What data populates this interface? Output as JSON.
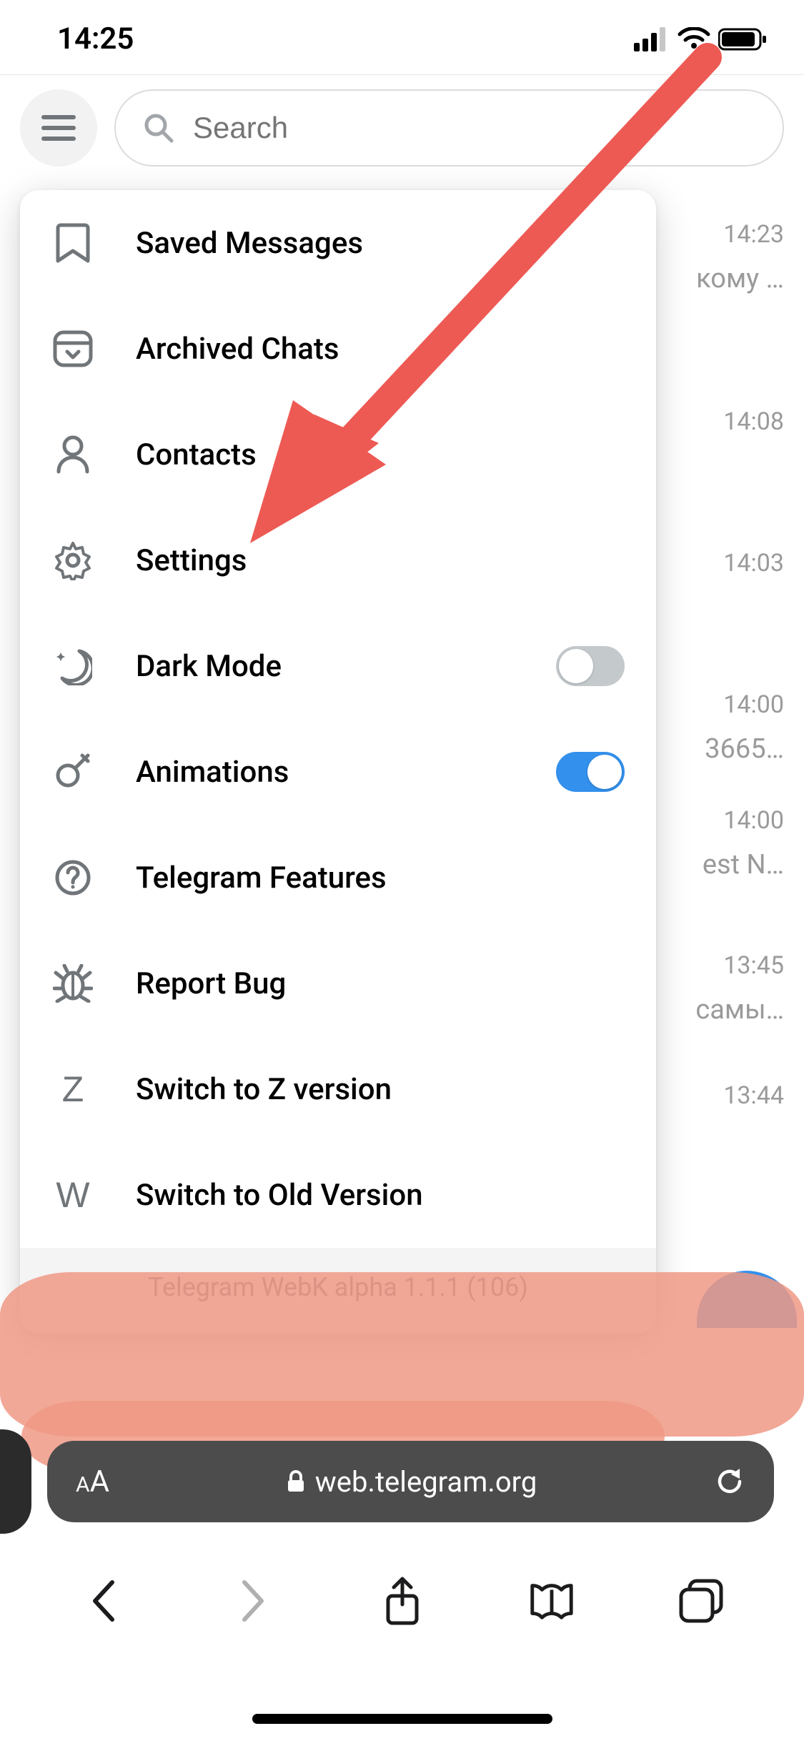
{
  "status": {
    "time": "14:25"
  },
  "search": {
    "placeholder": "Search"
  },
  "menu": {
    "items": [
      {
        "label": "Saved Messages",
        "icon": "bookmark"
      },
      {
        "label": "Archived Chats",
        "icon": "archive"
      },
      {
        "label": "Contacts",
        "icon": "user"
      },
      {
        "label": "Settings",
        "icon": "gear"
      },
      {
        "label": "Dark Mode",
        "icon": "moon",
        "toggle": false
      },
      {
        "label": "Animations",
        "icon": "sparkle",
        "toggle": true
      },
      {
        "label": "Telegram Features",
        "icon": "help"
      },
      {
        "label": "Report Bug",
        "icon": "bug"
      },
      {
        "label": "Switch to Z version",
        "icon": "Z"
      },
      {
        "label": "Switch to Old Version",
        "icon": "W"
      }
    ],
    "footer": "Telegram WebK alpha 1.1.1 (106)"
  },
  "chats_peek": [
    {
      "time": "14:23",
      "snippet": "кому …"
    },
    {
      "time": "14:08",
      "snippet": ""
    },
    {
      "time": "14:03",
      "snippet": ""
    },
    {
      "time": "14:00",
      "snippet": "3665…"
    },
    {
      "time": "14:00",
      "snippet": "est N…"
    },
    {
      "time": "13:45",
      "snippet": "самы…"
    },
    {
      "time": "13:44",
      "snippet": ""
    }
  ],
  "browser": {
    "url": "web.telegram.org",
    "text_size_label": "AA"
  },
  "annotation": {
    "arrow_color": "#ed5a54",
    "target": "settings-menu-item"
  }
}
